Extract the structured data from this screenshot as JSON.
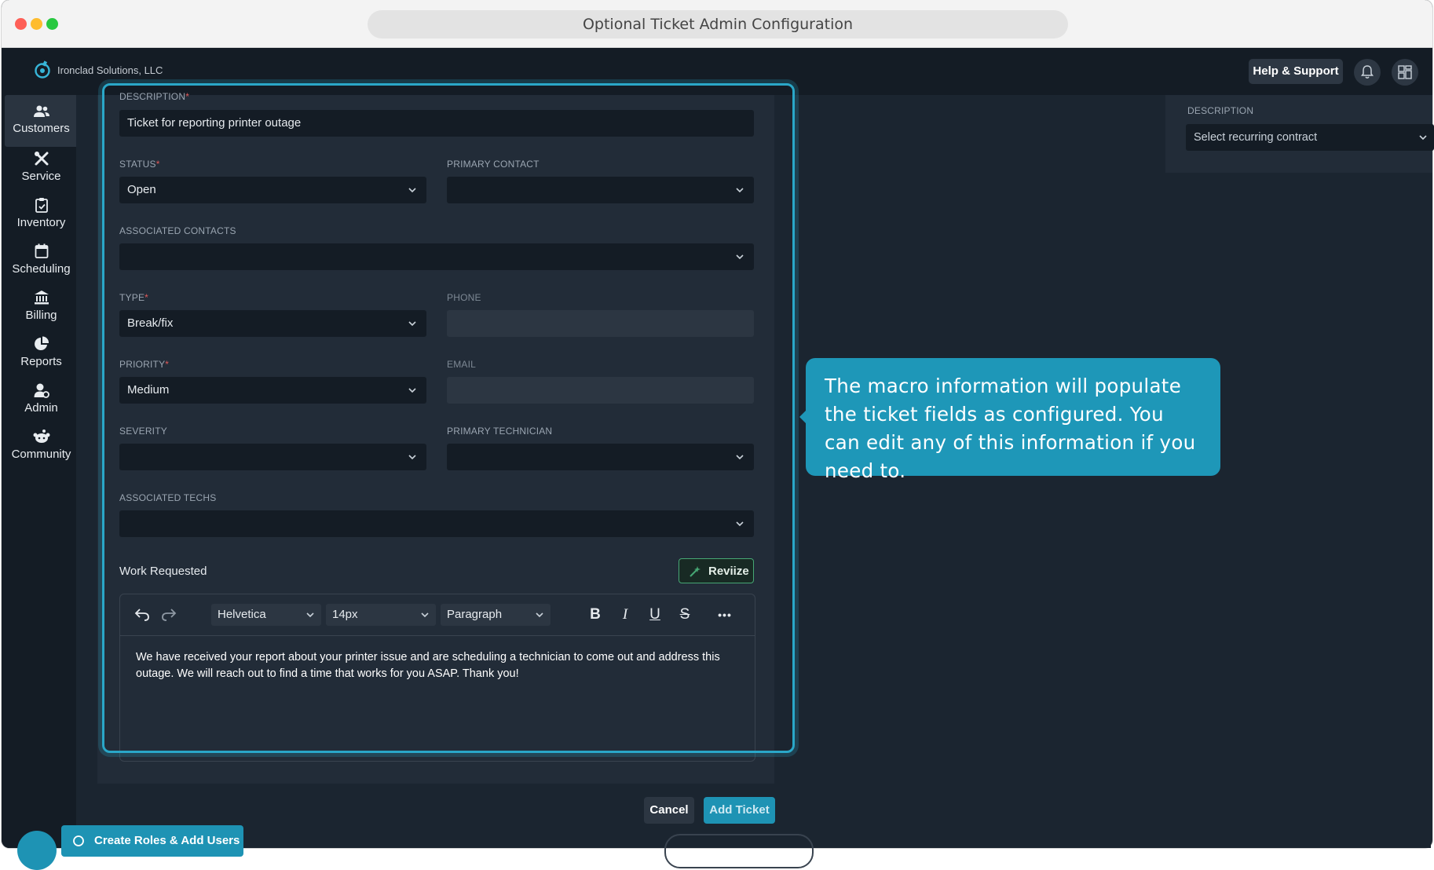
{
  "window": {
    "title": "Optional Ticket Admin Configuration"
  },
  "header": {
    "company": "Ironclad Solutions, LLC",
    "help_label": "Help & Support",
    "icons": [
      "bell-icon",
      "dashboard-icon"
    ]
  },
  "sidebar": {
    "items": [
      {
        "label": "Customers",
        "icon": "users-icon",
        "active": true
      },
      {
        "label": "Service",
        "icon": "tools-icon"
      },
      {
        "label": "Inventory",
        "icon": "clipboard-icon"
      },
      {
        "label": "Scheduling",
        "icon": "calendar-icon"
      },
      {
        "label": "Billing",
        "icon": "bank-icon"
      },
      {
        "label": "Reports",
        "icon": "pie-chart-icon"
      },
      {
        "label": "Admin",
        "icon": "user-gear-icon"
      },
      {
        "label": "Community",
        "icon": "community-icon"
      }
    ]
  },
  "form": {
    "description": {
      "label": "DESCRIPTION",
      "value": "Ticket for reporting printer outage",
      "required": true
    },
    "status": {
      "label": "STATUS",
      "value": "Open",
      "required": true
    },
    "primary_contact": {
      "label": "PRIMARY CONTACT",
      "value": ""
    },
    "associated_contacts": {
      "label": "ASSOCIATED CONTACTS",
      "value": ""
    },
    "type": {
      "label": "TYPE",
      "value": "Break/fix",
      "required": true
    },
    "phone": {
      "label": "PHONE",
      "value": ""
    },
    "priority": {
      "label": "PRIORITY",
      "value": "Medium",
      "required": true
    },
    "email": {
      "label": "EMAIL",
      "value": ""
    },
    "severity": {
      "label": "SEVERITY",
      "value": ""
    },
    "primary_technician": {
      "label": "PRIMARY TECHNICIAN",
      "value": ""
    },
    "associated_techs": {
      "label": "ASSOCIATED TECHS",
      "value": ""
    },
    "required_mark": "*"
  },
  "work_requested": {
    "label": "Work Requested",
    "reviize_label": "Reviize",
    "font_family": "Helvetica",
    "font_size": "14px",
    "block_format": "Paragraph",
    "toolbar_buttons": {
      "bold": "B",
      "italic": "I",
      "underline": "U",
      "strike": "S",
      "more": "•••"
    },
    "body_text": "We have received your report about your printer issue  and are scheduling a technician to come out and address this outage.  We will reach out to find a time that works for you ASAP. Thank you!"
  },
  "right_panel": {
    "label": "DESCRIPTION",
    "placeholder": "Select recurring contract"
  },
  "tooltip": {
    "text": "The macro information will populate the ticket fields as configured. You can edit any of this information if you need to."
  },
  "actions": {
    "cancel": "Cancel",
    "add_ticket": "Add Ticket"
  },
  "bottom": {
    "pill_label": "Create Roles & Add Users"
  },
  "colors": {
    "accent": "#1e97b8",
    "highlight": "#2aa7c8",
    "background": "#1b2530",
    "sidebar": "#141c25",
    "reviize_border": "#46a774",
    "required": "#e05a5a"
  }
}
